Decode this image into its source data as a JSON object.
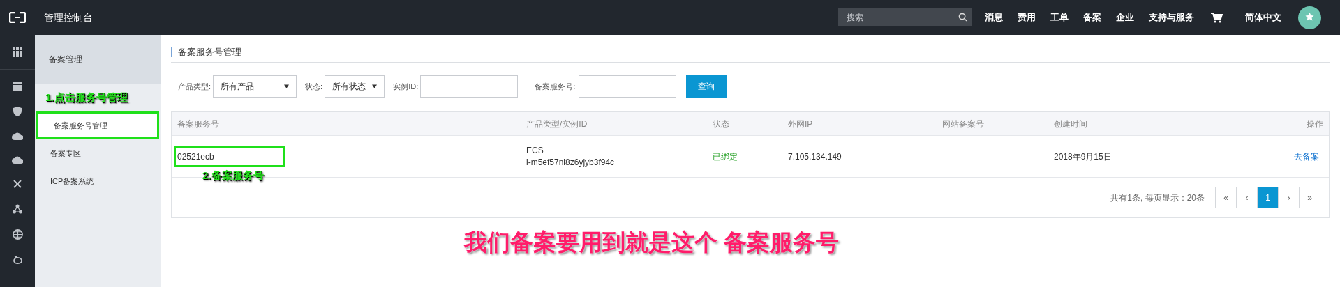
{
  "topbar": {
    "title": "管理控制台",
    "search": {
      "placeholder": "搜索"
    },
    "nav": [
      "消息",
      "费用",
      "工单",
      "备案",
      "企业",
      "支持与服务"
    ],
    "language": "简体中文"
  },
  "sidebar": {
    "title": "备案管理",
    "items": [
      {
        "label": "备案服务号管理",
        "selected": true,
        "highlighted": true
      },
      {
        "label": "备案专区",
        "selected": false,
        "highlighted": false
      },
      {
        "label": "ICP备案系统",
        "selected": false,
        "highlighted": false
      }
    ]
  },
  "page_title": "备案服务号管理",
  "filters": [
    {
      "kind": "select",
      "label": "产品类型:",
      "value": "所有产品"
    },
    {
      "kind": "select",
      "label": "状态:",
      "value": "所有状态"
    },
    {
      "kind": "input",
      "label": "实例ID:"
    },
    {
      "kind": "input",
      "label": "备案服务号:"
    }
  ],
  "query_button": "查询",
  "table": {
    "columns": [
      "备案服务号",
      "产品类型/实例ID",
      "状态",
      "外网IP",
      "网站备案号",
      "创建时间",
      "操作"
    ],
    "rows": [
      {
        "service_number": "02521ecb",
        "highlighted": true,
        "product": "ECS",
        "instance_id": "i-m5ef57ni8z6yjyb3f94c",
        "status": "已绑定",
        "ip": "7.105.134.149",
        "created": "2018年9月15日",
        "action": "去备案"
      }
    ]
  },
  "pagination": {
    "summary": "共有1条, 每页显示：20条",
    "pages": [
      {
        "label": "«",
        "selected": false
      },
      {
        "label": "‹",
        "selected": false
      },
      {
        "label": "1",
        "selected": true
      },
      {
        "label": "›",
        "selected": false
      },
      {
        "label": "»",
        "selected": false
      }
    ]
  },
  "annotations": [
    {
      "text": "1.点击服务号管理"
    },
    {
      "text": "2.备案服务号"
    },
    {
      "text": "我们备案要用到就是这个 备案服务号"
    }
  ]
}
